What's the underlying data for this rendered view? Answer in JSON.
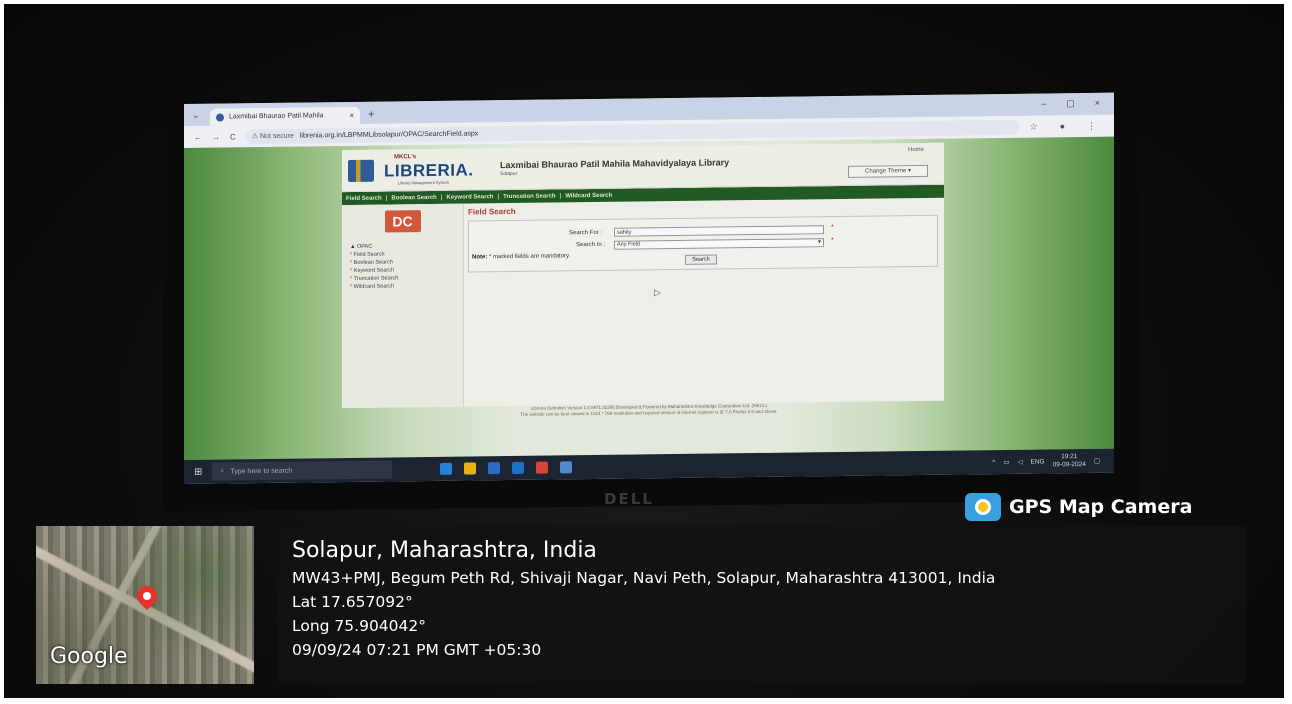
{
  "browser": {
    "tab_title": "Laxmibai Bhaurao Patil Mahila",
    "close_glyph": "×",
    "new_tab_glyph": "+",
    "minimize_glyph": "–",
    "maximize_glyph": "▢",
    "window_close_glyph": "×",
    "back_glyph": "←",
    "forward_glyph": "→",
    "reload_glyph": "C",
    "not_secure": "⚠ Not secure",
    "url": "librenia.org.in/LBPMMLibsolapur/OPAC/SearchField.aspx",
    "star_glyph": "☆",
    "profile_glyph": "●",
    "menu_glyph": "⋮"
  },
  "site": {
    "logo_mkcl": "MKCL's",
    "logo_text": "LIBRERIA.",
    "logo_subtitle": "Library Management System",
    "library_title": "Laxmibai Bhaurao Patil Mahila Mahavidyalaya Library",
    "library_city": "Solapur",
    "home_link": "Home",
    "change_theme_button": "Change Theme ▾",
    "menu": {
      "items": [
        "Field Search",
        "Boolean Search",
        "Keyword Search",
        "Truncation Search",
        "Wildcard Search"
      ],
      "separator": "|"
    },
    "dc_logo": "DC",
    "left_nav": {
      "head": "OPAC",
      "items": [
        "Field Search",
        "Boolean Search",
        "Keyword Search",
        "Truncation Search",
        "Wildcard Search"
      ]
    },
    "field_search": {
      "title": "Field Search",
      "search_for_label": "Search For :",
      "search_for_value": "sahity",
      "search_in_label": "Search In :",
      "search_in_value": "Any Field",
      "required_marker": "*",
      "note_label": "Note:",
      "note_text": "* marked fields are mandatory.",
      "search_button": "Search"
    },
    "footer_line1": "Libreria Definition Version 1.0.5971.32285   Developed & Powered by Maharashtra Knowledge Corporation Ltd. (MKCL)",
    "footer_line2": "The website can be best viewed in 1024 * 768 resolution and required version of internet explorer is IE 7.0,Firefox 3.0 and above."
  },
  "taskbar": {
    "search_placeholder": "Type here to search",
    "tray_language": "ENG",
    "tray_time": "19:21",
    "tray_date": "09-09-2024",
    "app_colors": [
      "#1e88e5",
      "#f2b705",
      "#2a6fd6",
      "#1976d2",
      "#e94235",
      "#4a90d9"
    ]
  },
  "monitor_brand": "DELL",
  "gps": {
    "brand": "GPS Map Camera",
    "map_label": "Google",
    "city": "Solapur, Maharashtra, India",
    "address": "MW43+PMJ, Begum Peth Rd, Shivaji Nagar, Navi Peth, Solapur, Maharashtra 413001, India",
    "lat": "Lat 17.657092°",
    "long": "Long 75.904042°",
    "datetime": "09/09/24 07:21 PM GMT +05:30"
  }
}
